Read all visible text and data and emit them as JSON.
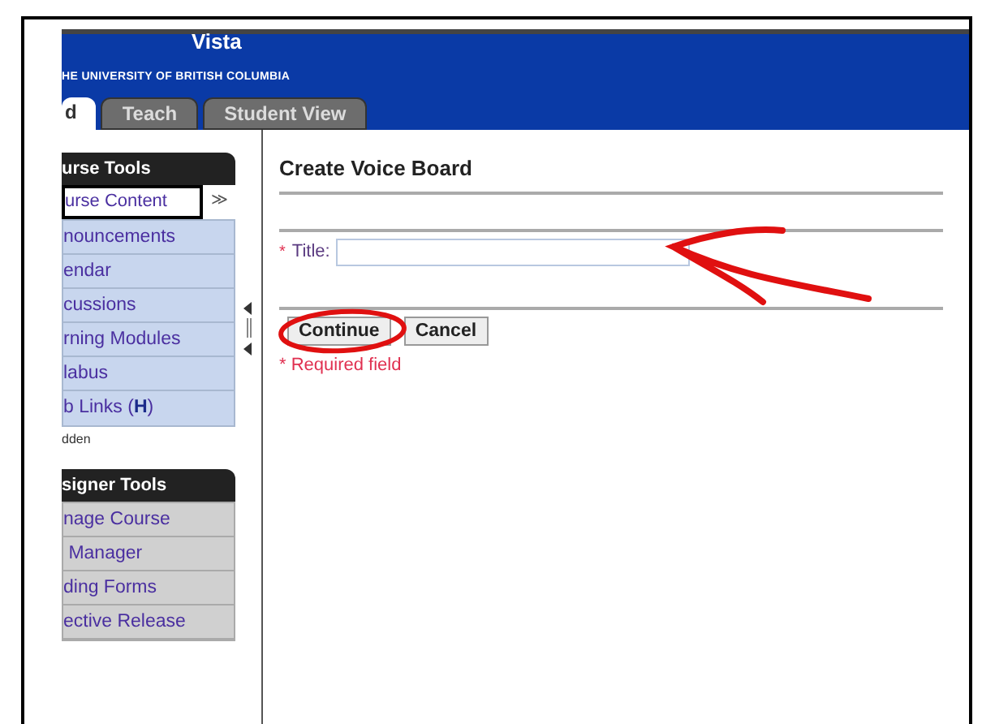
{
  "header": {
    "logo": "Vista",
    "subtitle": "HE UNIVERSITY OF  BRITISH COLUMBIA"
  },
  "tabs": [
    {
      "label": "d",
      "selected": true
    },
    {
      "label": "Teach",
      "selected": false
    },
    {
      "label": "Student View",
      "selected": false
    }
  ],
  "course_tools": {
    "title": "urse Tools",
    "dropdown": "urse Content",
    "dropdown_icon": "≫",
    "items": [
      "nouncements",
      "endar",
      "cussions",
      "rning Modules",
      "labus"
    ],
    "web_links": {
      "label": "b Links (",
      "bold": "H",
      "close": ")"
    },
    "note": "dden"
  },
  "designer_tools": {
    "title": "signer Tools",
    "items": [
      "nage Course",
      " Manager",
      "ding Forms",
      "ective Release"
    ]
  },
  "form": {
    "title": "Create Voice Board",
    "fields": [
      {
        "label": "Title:",
        "required": true,
        "required_mark": "*"
      }
    ],
    "buttons": [
      "Continue",
      "Cancel"
    ],
    "required_note": "* Required field"
  }
}
